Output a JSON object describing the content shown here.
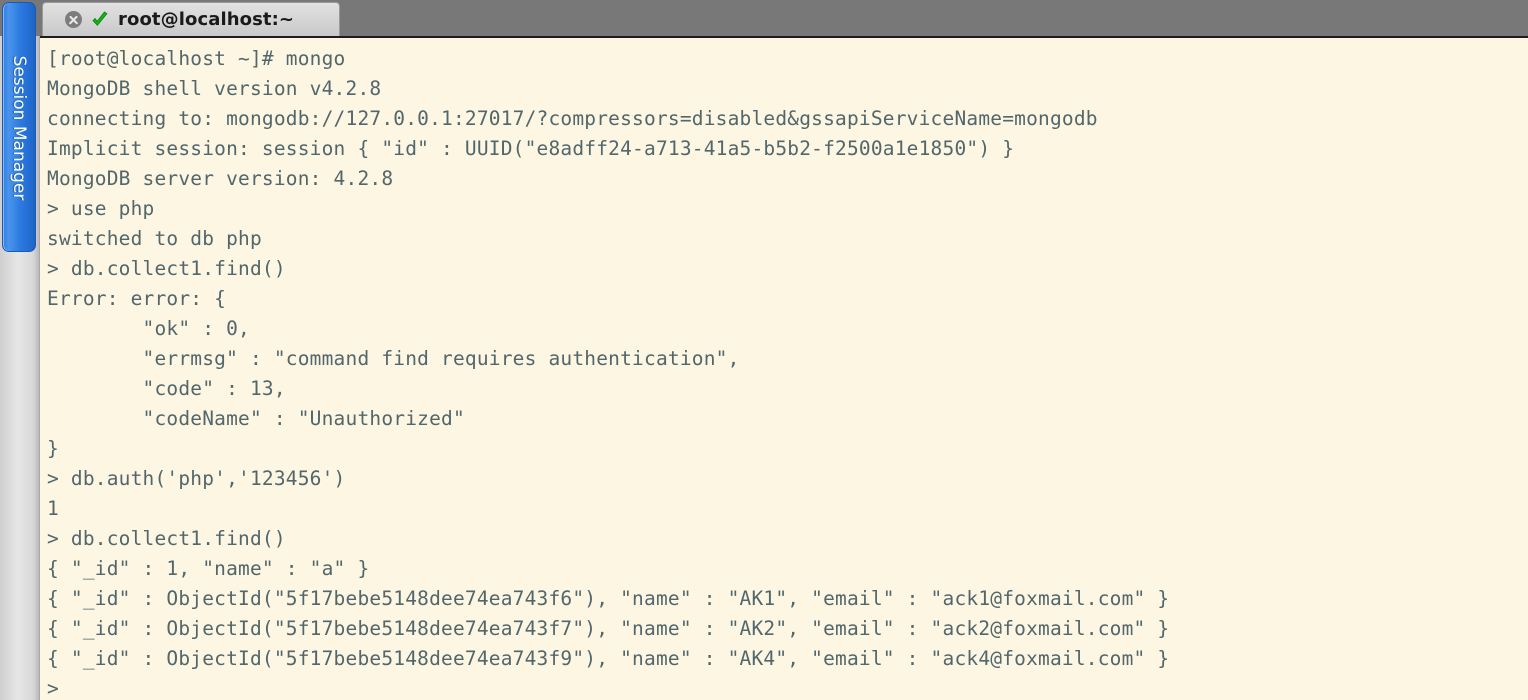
{
  "window": {
    "tab": {
      "title": "root@localhost:~",
      "close_icon": "close-circle-icon",
      "status_icon": "green-check-icon"
    },
    "titlebar_color": "#787878"
  },
  "sidebar": {
    "label": "Session Manager",
    "accent_color": "#2b7ae0"
  },
  "terminal": {
    "background_color": "#fdf6e3",
    "text_color": "#52676b",
    "shell_prompt": "[root@localhost ~]#",
    "mongo_prompt": ">",
    "lines": [
      "[root@localhost ~]# mongo",
      "MongoDB shell version v4.2.8",
      "connecting to: mongodb://127.0.0.1:27017/?compressors=disabled&gssapiServiceName=mongodb",
      "Implicit session: session { \"id\" : UUID(\"e8adff24-a713-41a5-b5b2-f2500a1e1850\") }",
      "MongoDB server version: 4.2.8",
      "> use php",
      "switched to db php",
      "> db.collect1.find()",
      "Error: error: {",
      "        \"ok\" : 0,",
      "        \"errmsg\" : \"command find requires authentication\",",
      "        \"code\" : 13,",
      "        \"codeName\" : \"Unauthorized\"",
      "}",
      "> db.auth('php','123456')",
      "1",
      "> db.collect1.find()",
      "{ \"_id\" : 1, \"name\" : \"a\" }",
      "{ \"_id\" : ObjectId(\"5f17bebe5148dee74ea743f6\"), \"name\" : \"AK1\", \"email\" : \"ack1@foxmail.com\" }",
      "{ \"_id\" : ObjectId(\"5f17bebe5148dee74ea743f7\"), \"name\" : \"AK2\", \"email\" : \"ack2@foxmail.com\" }",
      "{ \"_id\" : ObjectId(\"5f17bebe5148dee74ea743f9\"), \"name\" : \"AK4\", \"email\" : \"ack4@foxmail.com\" }",
      ">"
    ]
  }
}
